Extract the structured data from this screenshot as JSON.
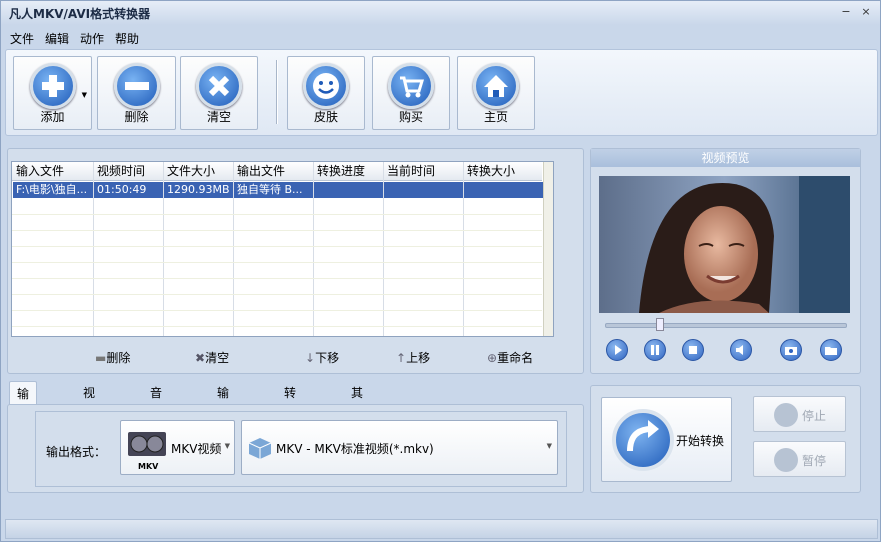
{
  "window": {
    "title": "凡人MKV/AVI格式转换器"
  },
  "menu": [
    "文件",
    "编辑",
    "动作",
    "帮助"
  ],
  "toolbar": {
    "add": "添加",
    "remove": "删除",
    "clear": "清空",
    "skin": "皮肤",
    "buy": "购买",
    "home": "主页"
  },
  "table": {
    "headers": [
      "输入文件",
      "视频时间",
      "文件大小",
      "输出文件",
      "转换进度",
      "当前时间",
      "转换大小"
    ],
    "rows": [
      [
        "F:\\电影\\独自...",
        "01:50:49",
        "1290.93MB",
        "独自等待 B...",
        "",
        "",
        ""
      ]
    ]
  },
  "list_actions": {
    "remove": "删除",
    "clear": "清空",
    "down": "下移",
    "up": "上移",
    "rename": "重命名"
  },
  "preview": {
    "title": "视频预览"
  },
  "tabs": [
    "输出格式",
    "视频参数",
    "音频参数",
    "输出目录",
    "转换设置",
    "其他设置"
  ],
  "format": {
    "label": "输出格式：",
    "type": "MKV视频",
    "icon_text": "MKV",
    "profile": "MKV - MKV标准视频(*.mkv)"
  },
  "actions": {
    "start": "开始转换",
    "stop": "停止",
    "pause": "暂停"
  },
  "colors": {
    "selection": "#3a63b3",
    "accent": "#2f63c0"
  }
}
